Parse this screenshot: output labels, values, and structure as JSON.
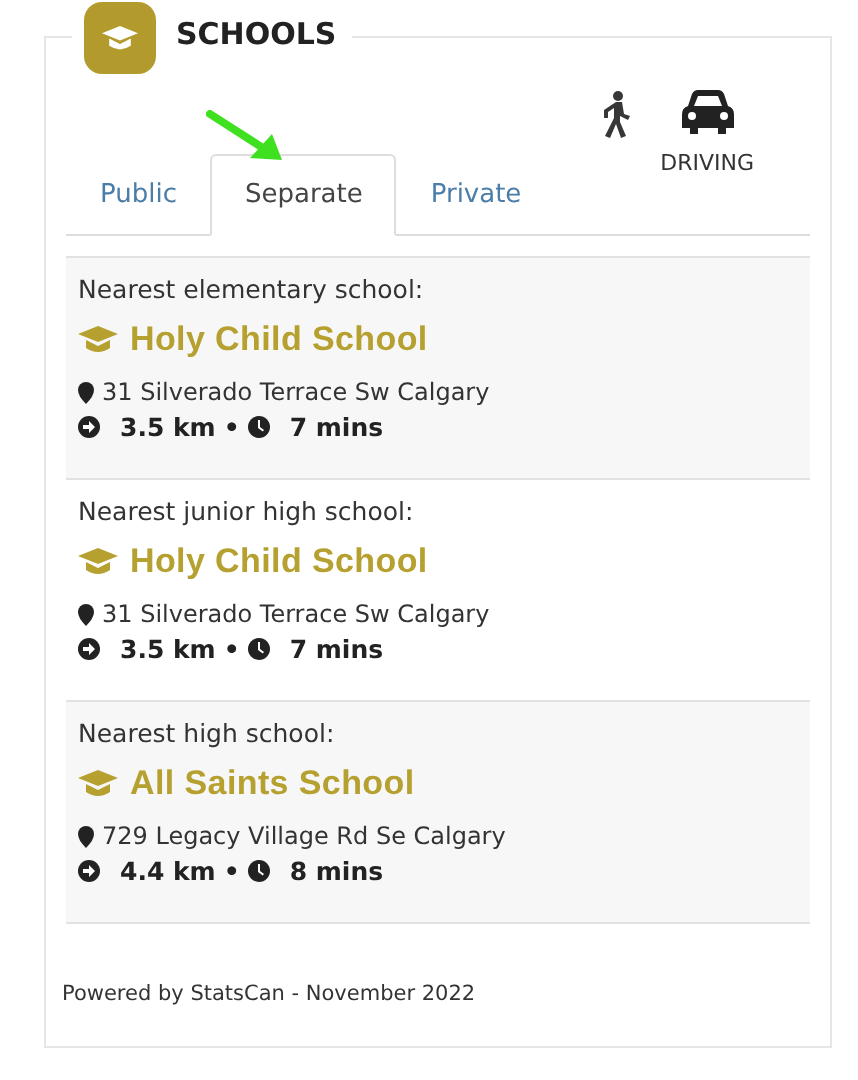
{
  "header": {
    "title": "SCHOOLS"
  },
  "travel_modes": [
    {
      "kind": "walk",
      "selected": false
    },
    {
      "kind": "drive",
      "label": "DRIVING",
      "selected": true
    }
  ],
  "tabs": [
    {
      "label": "Public",
      "selected": false
    },
    {
      "label": "Separate",
      "selected": true
    },
    {
      "label": "Private",
      "selected": false
    }
  ],
  "schools": [
    {
      "level_label": "Nearest elementary school:",
      "name": "Holy Child School",
      "address": "31 Silverado Terrace Sw Calgary",
      "distance": "3.5 km",
      "separator": "•",
      "duration": "7 mins"
    },
    {
      "level_label": "Nearest junior high school:",
      "name": "Holy Child School",
      "address": "31 Silverado Terrace Sw Calgary",
      "distance": "3.5 km",
      "separator": "•",
      "duration": "7 mins"
    },
    {
      "level_label": "Nearest high school:",
      "name": "All Saints School",
      "address": "729 Legacy Village Rd Se Calgary",
      "distance": "4.4 km",
      "separator": "•",
      "duration": "8 mins"
    }
  ],
  "footer": "Powered by StatsCan - November 2022"
}
